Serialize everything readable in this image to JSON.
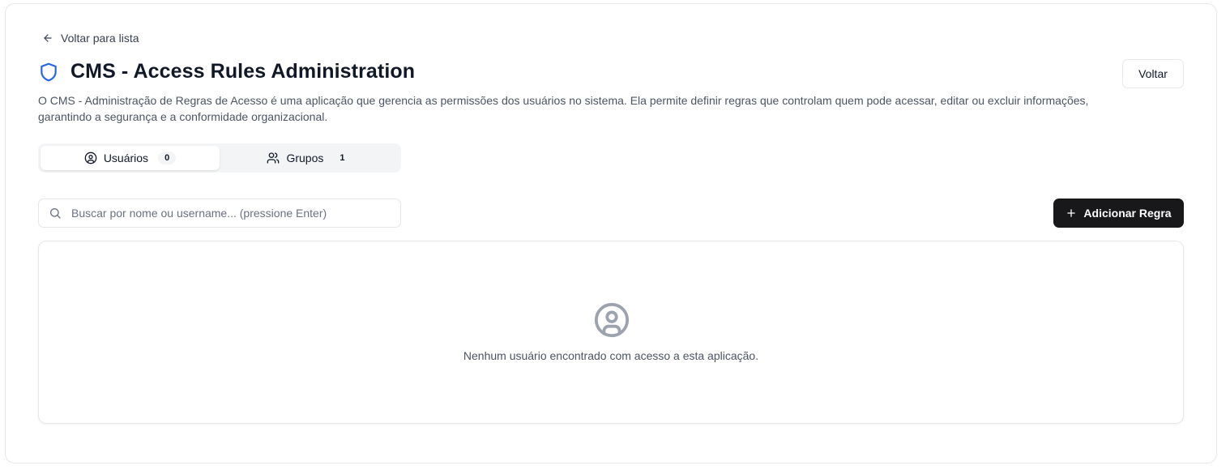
{
  "nav": {
    "back_label": "Voltar para lista"
  },
  "header": {
    "title": "CMS - Access Rules Administration",
    "back_button": "Voltar",
    "description": "O CMS - Administração de Regras de Acesso é uma aplicação que gerencia as permissões dos usuários no sistema. Ela permite definir regras que controlam quem pode acessar, editar ou excluir informações, garantindo a segurança e a conformidade organizacional."
  },
  "tabs": [
    {
      "label": "Usuários",
      "count": "0",
      "icon": "user-circle-icon",
      "active": true
    },
    {
      "label": "Grupos",
      "count": "1",
      "icon": "users-icon",
      "active": false
    }
  ],
  "search": {
    "placeholder": "Buscar por nome ou username... (pressione Enter)",
    "value": ""
  },
  "actions": {
    "add_rule": "Adicionar Regra"
  },
  "empty_state": {
    "icon": "user-circle-icon",
    "message": "Nenhum usuário encontrado com acesso a esta aplicação."
  },
  "colors": {
    "accent": "#2563eb",
    "primary_button": "#18181b",
    "border": "#e5e7eb",
    "muted_text": "#4b5563"
  }
}
